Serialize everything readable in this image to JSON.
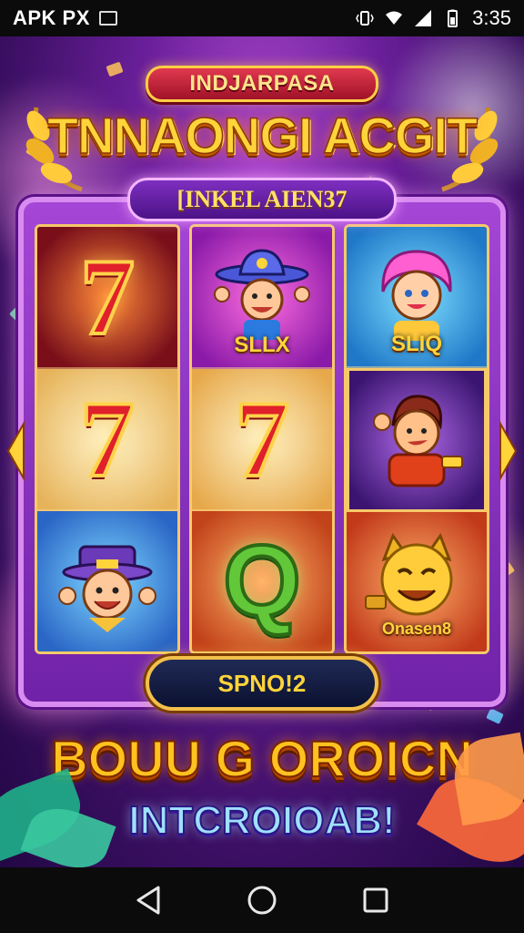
{
  "status_bar": {
    "app_label": "APK PX",
    "time": "3:35",
    "icons": [
      "notification-square-icon",
      "vibrate-icon",
      "wifi-icon",
      "signal-icon",
      "battery-icon"
    ]
  },
  "game": {
    "ribbon_title": "INDJARPASA",
    "main_title": "TNNAONGI ACGIT",
    "badge_text": "[INKEL AIEN37",
    "reels": [
      [
        {
          "symbol": "seven-icon",
          "glyph": "7",
          "label": ""
        },
        {
          "symbol": "seven-icon",
          "glyph": "7",
          "label": ""
        },
        {
          "symbol": "leprechaun-icon",
          "glyph": "",
          "label": ""
        }
      ],
      [
        {
          "symbol": "cowboy-character-icon",
          "glyph": "",
          "label": "SLLX"
        },
        {
          "symbol": "seven-icon",
          "glyph": "7",
          "label": ""
        },
        {
          "symbol": "q-letter-icon",
          "glyph": "Q",
          "label": ""
        }
      ],
      [
        {
          "symbol": "pink-hair-character-icon",
          "glyph": "",
          "label": "SLIQ"
        },
        {
          "symbol": "hero-character-icon",
          "glyph": "",
          "label": ""
        },
        {
          "symbol": "golden-cat-icon",
          "glyph": "",
          "label": "Onasen8"
        }
      ]
    ],
    "spin_button_label": "SPNO!2",
    "bonus_text": "BOUU G OROICN",
    "tagline": "INTCROIOAB!",
    "colors": {
      "title_gold": "#ffd43a",
      "frame_purple": "#a546d6",
      "seven_red": "#e0202a",
      "q_green": "#62c83a",
      "tagline_blue": "#9fe0ff"
    }
  },
  "nav_bar": {
    "icons": [
      "back-triangle-icon",
      "home-circle-icon",
      "recents-square-icon"
    ]
  }
}
